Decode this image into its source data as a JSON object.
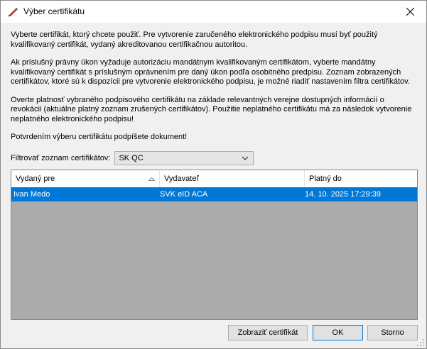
{
  "window": {
    "title": "Výber certifikátu",
    "title_icon": "pen-signature-icon",
    "close_icon": "close-icon"
  },
  "paragraphs": [
    "Vyberte certifikát, ktorý chcete použiť. Pre vytvorenie zaručeného elektronického podpisu musí byť použitý kvalifikovaný certifikát, vydaný akreditovanou certifikačnou autoritou.",
    "Ak príslušný právny úkon vyžaduje autorizáciu mandátnym kvalifikovaným certifikátom, vyberte mandátny kvalifikovaný certifikát s príslušným oprávnením pre daný úkon podľa osobitného predpisu. Zoznam zobrazených certifikátov, ktoré sú k dispozícii pre vytvorenie elektronického podpisu, je možné riadiť nastavením filtra certifikátov.",
    "Overte platnosť vybraného podpisového certifikátu na základe relevantných verejne dostupných informácií o revokácii (aktuálne platný zoznam zrušených certifikátov). Použitie neplatného certifikátu má za následok vytvorenie neplatného elektronického podpisu!",
    "Potvrdením výberu certifikátu podpíšete dokument!"
  ],
  "filter": {
    "label": "Filtrovať zoznam certifikátov:",
    "selected": "SK QC"
  },
  "table": {
    "columns": [
      "Vydaný pre",
      "Vydavateľ",
      "Platný do"
    ],
    "sorted_column": "Vydaný pre",
    "rows": [
      {
        "issued_to": "Ivan Medo",
        "issuer": "SVK eID ACA",
        "valid_to": "14. 10. 2025 17:29:39",
        "selected": true
      }
    ]
  },
  "buttons": {
    "show_certificate": "Zobraziť certifikát",
    "ok": "OK",
    "cancel": "Storno"
  },
  "colors": {
    "selection": "#0078d7",
    "dialog_bg": "#f0f0f0",
    "list_empty_bg": "#ababab"
  }
}
